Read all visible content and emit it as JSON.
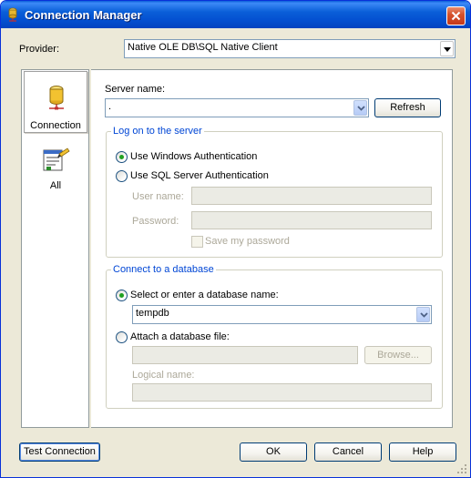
{
  "window": {
    "title": "Connection Manager",
    "close_icon": "close-icon"
  },
  "provider": {
    "label": "Provider:",
    "value": "Native OLE DB\\SQL Native Client"
  },
  "sidebar": {
    "items": [
      {
        "label": "Connection",
        "icon": "database-icon",
        "selected": true
      },
      {
        "label": "All",
        "icon": "properties-icon",
        "selected": false
      }
    ]
  },
  "server": {
    "label": "Server name:",
    "value": ".",
    "refresh_label": "Refresh"
  },
  "logon": {
    "title": "Log on to the server",
    "windows_auth_label": "Use Windows Authentication",
    "sql_auth_label": "Use SQL Server Authentication",
    "selected": "windows",
    "username_label": "User name:",
    "username_value": "",
    "password_label": "Password:",
    "password_value": "",
    "save_password_label": "Save my password",
    "save_password_checked": false
  },
  "database": {
    "title": "Connect to a database",
    "select_label": "Select or enter a database name:",
    "select_value": "tempdb",
    "attach_label": "Attach a database file:",
    "attach_value": "",
    "browse_label": "Browse...",
    "logical_name_label": "Logical name:",
    "logical_name_value": "",
    "selected": "select"
  },
  "footer": {
    "test_label": "Test Connection",
    "ok_label": "OK",
    "cancel_label": "Cancel",
    "help_label": "Help"
  },
  "colors": {
    "titlebar": "#0a5fd8",
    "dialog_bg": "#ece9d8",
    "group_title": "#0046d5",
    "radio_dot": "#21a121"
  }
}
